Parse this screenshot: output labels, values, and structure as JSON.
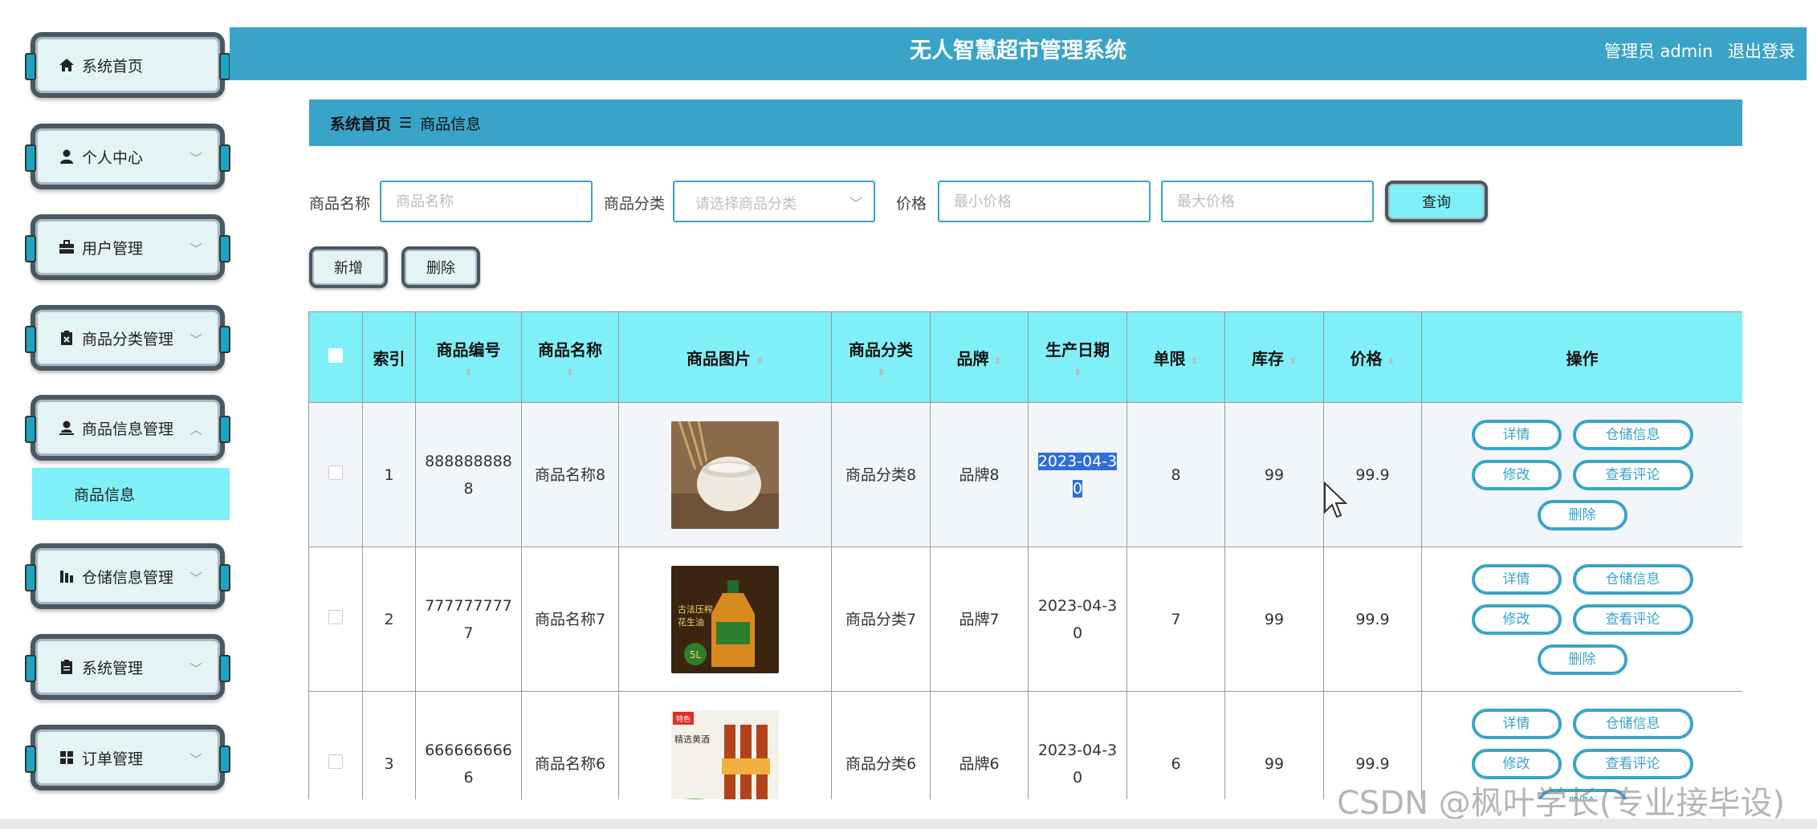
{
  "app": {
    "title": "无人智慧超市管理系统",
    "user_label": "管理员 admin",
    "logout_label": "退出登录"
  },
  "sidebar": {
    "items": [
      {
        "label": "系统首页",
        "icon": "home-icon"
      },
      {
        "label": "个人中心",
        "icon": "user-icon"
      },
      {
        "label": "用户管理",
        "icon": "briefcase-icon"
      },
      {
        "label": "商品分类管理",
        "icon": "clipboard-x-icon"
      },
      {
        "label": "商品信息管理",
        "icon": "user-admin-icon"
      },
      {
        "label": "仓储信息管理",
        "icon": "bar-chart-icon"
      },
      {
        "label": "系统管理",
        "icon": "clipboard-icon"
      },
      {
        "label": "订单管理",
        "icon": "grid-icon"
      }
    ],
    "sub_item": {
      "label": "商品信息"
    }
  },
  "breadcrumb": {
    "home": "系统首页",
    "separator": "☰",
    "current": "商品信息"
  },
  "search": {
    "name_label": "商品名称",
    "name_placeholder": "商品名称",
    "category_label": "商品分类",
    "category_placeholder": "请选择商品分类",
    "price_label": "价格",
    "min_price_placeholder": "最小价格",
    "max_price_placeholder": "最大价格",
    "query_label": "查询"
  },
  "actions": {
    "add_label": "新增",
    "delete_label": "删除"
  },
  "table": {
    "headers": {
      "index": "索引",
      "code": "商品编号",
      "name": "商品名称",
      "image": "商品图片",
      "category": "商品分类",
      "brand": "品牌",
      "date": "生产日期",
      "limit": "单限",
      "stock": "库存",
      "price": "价格",
      "ops": "操作"
    },
    "rows": [
      {
        "index": "1",
        "code": "8888888888",
        "name": "商品名称8",
        "category": "商品分类8",
        "brand": "品牌8",
        "date": "2023-04-30",
        "limit": "8",
        "stock": "99",
        "price": "99.9"
      },
      {
        "index": "2",
        "code": "7777777777",
        "name": "商品名称7",
        "category": "商品分类7",
        "brand": "品牌7",
        "date": "2023-04-30",
        "limit": "7",
        "stock": "99",
        "price": "99.9"
      },
      {
        "index": "3",
        "code": "6666666666",
        "name": "商品名称6",
        "category": "商品分类6",
        "brand": "品牌6",
        "date": "2023-04-30",
        "limit": "6",
        "stock": "99",
        "price": "99.9"
      }
    ],
    "row_ops": {
      "detail": "详情",
      "storage": "仓储信息",
      "edit": "修改",
      "comments": "查看评论",
      "delete": "删除"
    }
  },
  "image_text": {
    "oil_brand": "古法压榨",
    "oil_sub": "花生油",
    "oil_volume": "5L",
    "vinegar_brand": "特色",
    "vinegar_title": "精选黄酒"
  },
  "watermark": "CSDN @枫叶学长(专业接毕设)",
  "colors": {
    "header": "#3aa4c8",
    "accent": "#7ff0f7",
    "frame": "#4a5862"
  }
}
